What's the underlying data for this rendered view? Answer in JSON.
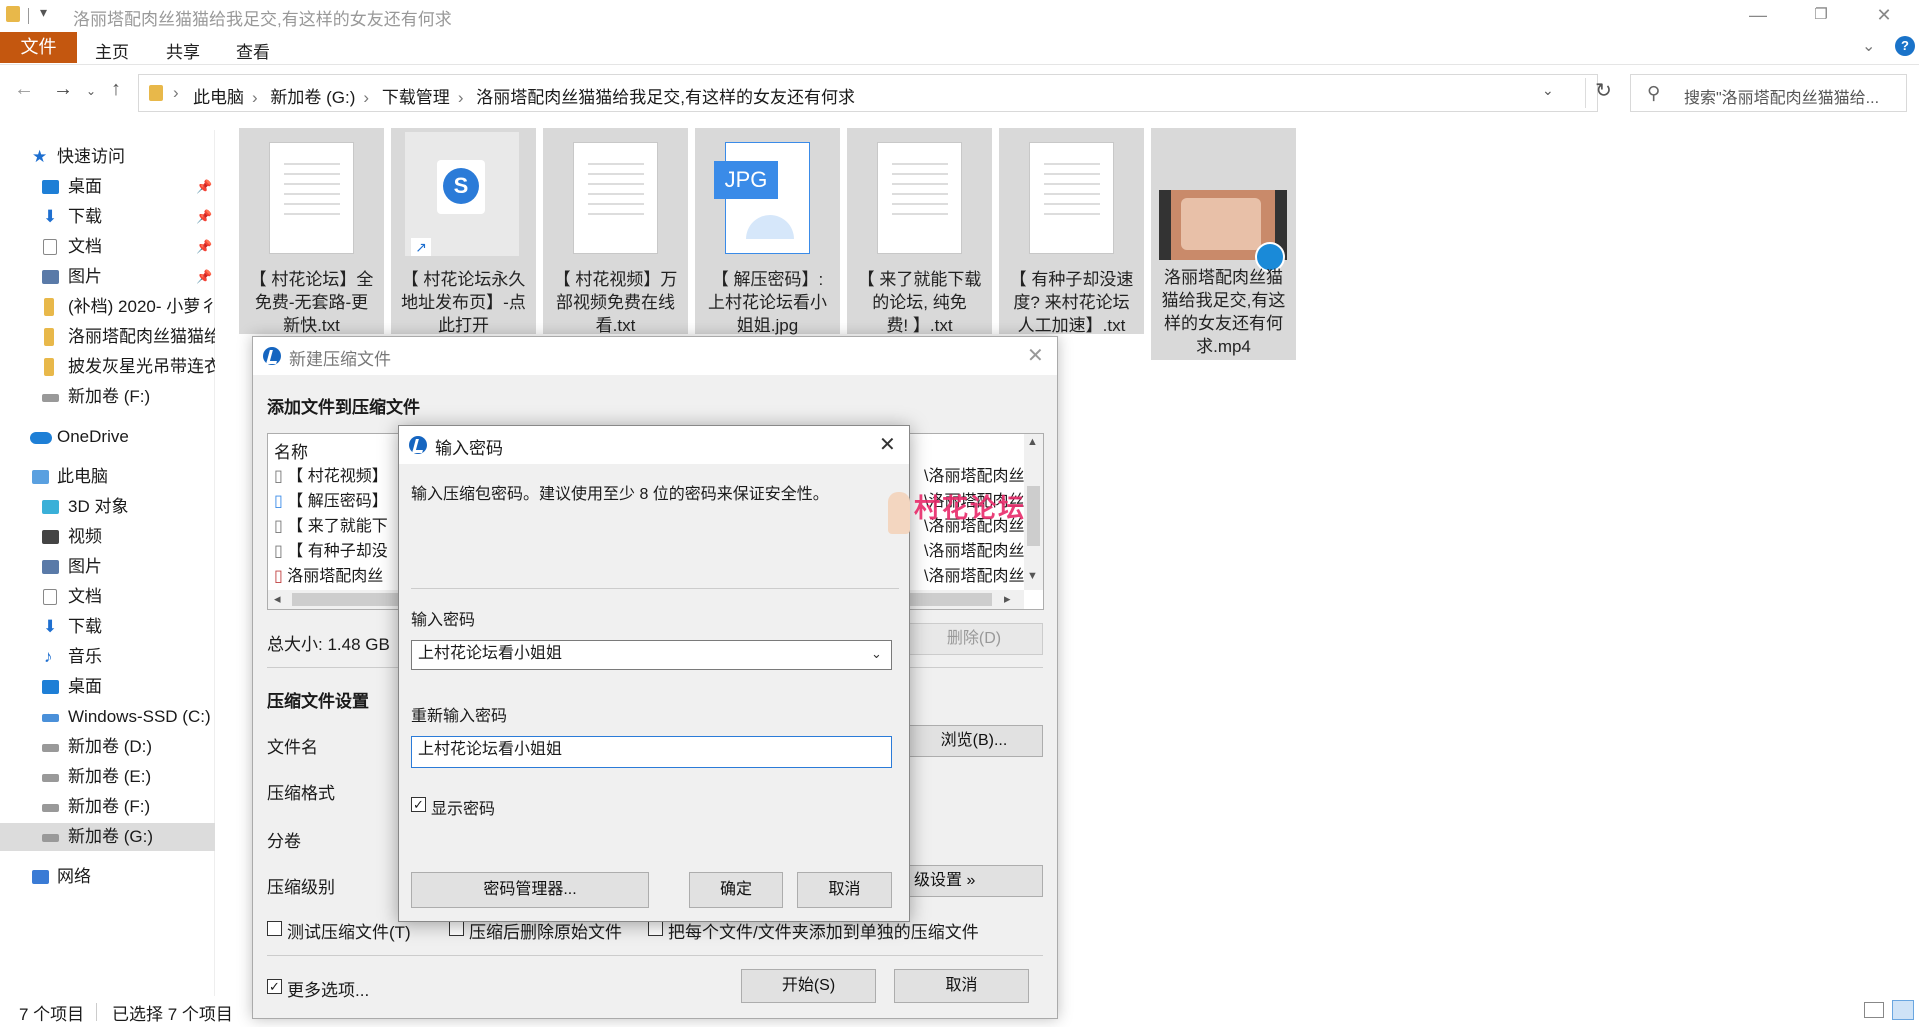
{
  "window": {
    "title": "洛丽塔配肉丝猫猫给我足交,有这样的女友还有何求",
    "minimize": "—",
    "maximize": "❐",
    "close": "✕"
  },
  "ribbon": {
    "file_tab": "文件",
    "tabs": [
      "主页",
      "共享",
      "查看"
    ]
  },
  "address": {
    "crumbs": [
      "此电脑",
      "新加卷 (G:)",
      "下载管理",
      "洛丽塔配肉丝猫猫给我足交,有这样的女友还有何求"
    ],
    "search_placeholder": "搜索\"洛丽塔配肉丝猫猫给..."
  },
  "nav": {
    "quick_access": "快速访问",
    "quick_items": [
      "桌面",
      "下载",
      "文档",
      "图片",
      "(补档) 2020- 小萝彳",
      "洛丽塔配肉丝猫猫给",
      "披发灰星光吊带连衣",
      "新加卷 (F:)"
    ],
    "onedrive": "OneDrive",
    "this_pc": "此电脑",
    "pc_items": [
      "3D 对象",
      "视频",
      "图片",
      "文档",
      "下载",
      "音乐",
      "桌面",
      "Windows-SSD (C:)",
      "新加卷 (D:)",
      "新加卷 (E:)",
      "新加卷 (F:)",
      "新加卷 (G:)"
    ],
    "network": "网络"
  },
  "files": [
    {
      "name": [
        "【 村花论坛】全",
        "免费-无套路-更",
        "新快.txt"
      ],
      "type": "txt"
    },
    {
      "name": [
        "【 村花论坛永久",
        "地址发布页】-点",
        "此打开"
      ],
      "type": "shortcut"
    },
    {
      "name": [
        "【 村花视频】万",
        "部视频免费在线",
        "看.txt"
      ],
      "type": "txt"
    },
    {
      "name": [
        "【 解压密码】:",
        "上村花论坛看小",
        "姐姐.jpg"
      ],
      "type": "jpg",
      "badge": "JPG"
    },
    {
      "name": [
        "【 来了就能下载",
        "的论坛, 纯免",
        "费! 】.txt"
      ],
      "type": "txt"
    },
    {
      "name": [
        "【 有种子却没速",
        "度? 来村花论坛",
        "人工加速】.txt"
      ],
      "type": "txt"
    },
    {
      "name": [
        "洛丽塔配肉丝猫",
        "猫给我足交,有这",
        "样的女友还有何",
        "求.mp4"
      ],
      "type": "mp4"
    }
  ],
  "status": {
    "count": "7 个项目",
    "selected": "已选择 7 个项目"
  },
  "archive_dialog": {
    "title": "新建压缩文件",
    "add_files_label": "添加文件到压缩文件",
    "col_name": "名称",
    "rows": [
      "【 村花视频】",
      "【 解压密码】",
      "【 来了就能下",
      "【 有种子却没",
      "洛丽塔配肉丝"
    ],
    "right_col": [
      "\\洛丽塔配肉丝",
      "\\洛丽塔配肉丝",
      "\\洛丽塔配肉丝",
      "\\洛丽塔配肉丝",
      "\\洛丽塔配肉丝"
    ],
    "total_size": "总大小: 1.48 GB",
    "delete_button": "删除(D)",
    "settings_header": "压缩文件设置",
    "filename_label": "文件名",
    "format_label": "压缩格式",
    "volume_label": "分卷",
    "level_label": "压缩级别",
    "browse_button": "浏览(B)...",
    "advanced_button": "级设置 »",
    "test_checkbox": "测试压缩文件(T)",
    "delete_after": "压缩后删除原始文件",
    "separate": "把每个文件/文件夹添加到单独的压缩文件",
    "more_options": "更多选项...",
    "start_button": "开始(S)",
    "cancel_button": "取消"
  },
  "password_dialog": {
    "title": "输入密码",
    "hint": "输入压缩包密码。建议使用至少 8 位的密码来保证安全性。",
    "password_label": "输入密码",
    "password_value": "上村花论坛看小姐姐",
    "reenter_label": "重新输入密码",
    "reenter_value": "上村花论坛看小姐姐",
    "show_password": "显示密码",
    "manager_button": "密码管理器...",
    "ok_button": "确定",
    "cancel_button": "取消"
  },
  "watermark": "村花论坛"
}
